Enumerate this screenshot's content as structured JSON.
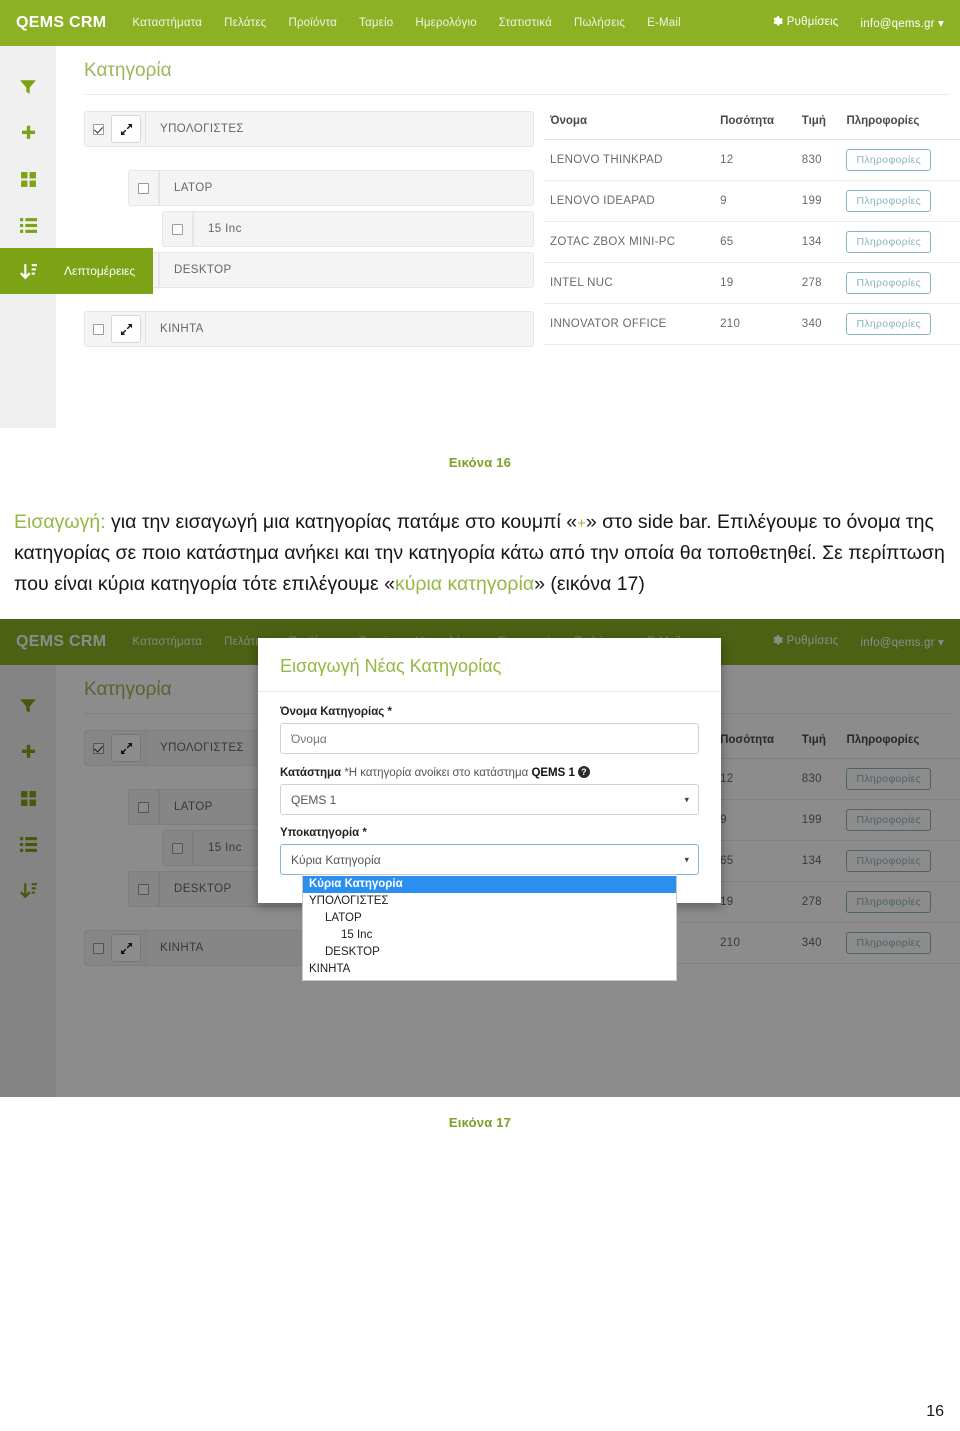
{
  "navbar": {
    "brand": "QEMS CRM",
    "links": [
      "Καταστήματα",
      "Πελάτες",
      "Προϊόντα",
      "Ταμείο",
      "Ημερολόγιο",
      "Στατιστικά",
      "Πωλήσεις",
      "E-Mail"
    ],
    "settings_label": "Ρυθμίσεις",
    "account_label": "info@qems.gr ▾",
    "gear_icon": "gear-icon"
  },
  "sidebar": {
    "items": [
      {
        "icon": "filter-icon",
        "tooltip": ""
      },
      {
        "icon": "plus-icon",
        "tooltip": ""
      },
      {
        "icon": "grid-icon",
        "tooltip": ""
      },
      {
        "icon": "list-icon",
        "tooltip": ""
      },
      {
        "icon": "sort-descending-icon",
        "tooltip": "Λεπτομέρειες"
      }
    ],
    "active_index": 4
  },
  "page": {
    "title": "Κατηγορία"
  },
  "categories": [
    {
      "label": "ΥΠΟΛΟΓΙΣΤΕΣ",
      "checked": true,
      "expandable": true,
      "indent": 0
    },
    {
      "label": "LATOP",
      "checked": false,
      "expandable": false,
      "indent": 1
    },
    {
      "label": "15 Inc",
      "checked": false,
      "expandable": false,
      "indent": 2
    },
    {
      "label": "DESKTOP",
      "checked": false,
      "expandable": false,
      "indent": 1
    },
    {
      "label": "ΚΙΝΗΤΑ",
      "checked": false,
      "expandable": true,
      "indent": 0
    }
  ],
  "table": {
    "headers": [
      "Όνομα",
      "Ποσότητα",
      "Τιμή",
      "Πληροφορίες"
    ],
    "info_label": "Πληροφορίες",
    "rows": [
      {
        "name": "LENOVO THINKPAD",
        "qty": "12",
        "price": "830"
      },
      {
        "name": "LENOVO IDEAPAD",
        "qty": "9",
        "price": "199"
      },
      {
        "name": "ZOTAC ZBOX MINI-PC",
        "qty": "65",
        "price": "134"
      },
      {
        "name": "INTEL NUC",
        "qty": "19",
        "price": "278"
      },
      {
        "name": "INNOVATOR OFFICE",
        "qty": "210",
        "price": "340"
      }
    ]
  },
  "figure16": {
    "caption": "Εικόνα 16"
  },
  "figure17": {
    "caption": "Εικόνα 17"
  },
  "prose": {
    "lead": "Εισαγωγή:",
    "part1": " για την εισαγωγή μια κατηγορίας πατάμε στο κουμπί «",
    "plus": "+",
    "part2": "» στο side bar. Επιλέγουμε το όνομα της κατηγορίας σε ποιο κατάστημα ανήκει και την κατηγορία κάτω από την οποία θα τοποθετηθεί. Σε περίπτωση που είναι κύρια κατηγορία τότε επιλέγουμε «",
    "accent": "κύρια κατηγορία",
    "part3": "»  (εικόνα 17)"
  },
  "modal": {
    "title": "Εισαγωγή Νέας Κατηγορίας",
    "name_label": "Όνομα Κατηγορίας *",
    "name_placeholder": "Όνομα",
    "store_label": "Κατάστημα",
    "store_hint": "*Η κατηγορία ανοίκει στο κατάστημα",
    "store_hint_strong": "QEMS 1",
    "store_help_icon": "question-mark-icon",
    "store_value": "QEMS 1",
    "subcat_label": "Υποκατηγορία *",
    "subcat_value": "Κύρια Κατηγορία",
    "dropdown_options": [
      {
        "label": "Κύρια Κατηγορία",
        "level": 0,
        "selected": true
      },
      {
        "label": "ΥΠΟΛΟΓΙΣΤΕΣ",
        "level": 0,
        "selected": false
      },
      {
        "label": "LATOP",
        "level": 1,
        "selected": false
      },
      {
        "label": "15 Inc",
        "level": 2,
        "selected": false
      },
      {
        "label": "DESKTOP",
        "level": 1,
        "selected": false
      },
      {
        "label": "ΚΙΝΗΤΑ",
        "level": 0,
        "selected": false
      }
    ]
  },
  "footer": {
    "page_number": "16"
  },
  "colors": {
    "brand_green": "#8db125",
    "accent_green": "#93b944",
    "sidebar_active": "#7ca316",
    "select_blue": "#2a8fef",
    "info_btn": "#8ab4bd"
  }
}
